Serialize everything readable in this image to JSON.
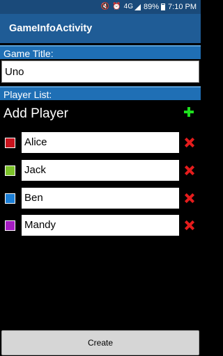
{
  "status_bar": {
    "signal_text": "4G",
    "battery": "89%",
    "time": "7:10 PM"
  },
  "app": {
    "title": "GameInfoActivity"
  },
  "game": {
    "title_label": "Game Title:",
    "title_value": "Uno"
  },
  "players": {
    "section_label": "Player List:",
    "add_label": "Add Player",
    "items": [
      {
        "name": "Alice",
        "color": "#c8141e"
      },
      {
        "name": "Jack",
        "color": "#7cc22a"
      },
      {
        "name": "Ben",
        "color": "#1c7fd6"
      },
      {
        "name": "Mandy",
        "color": "#a51cc2"
      }
    ]
  },
  "actions": {
    "create_label": "Create"
  },
  "icons": {
    "add": "plus-icon",
    "remove": "close-icon"
  }
}
